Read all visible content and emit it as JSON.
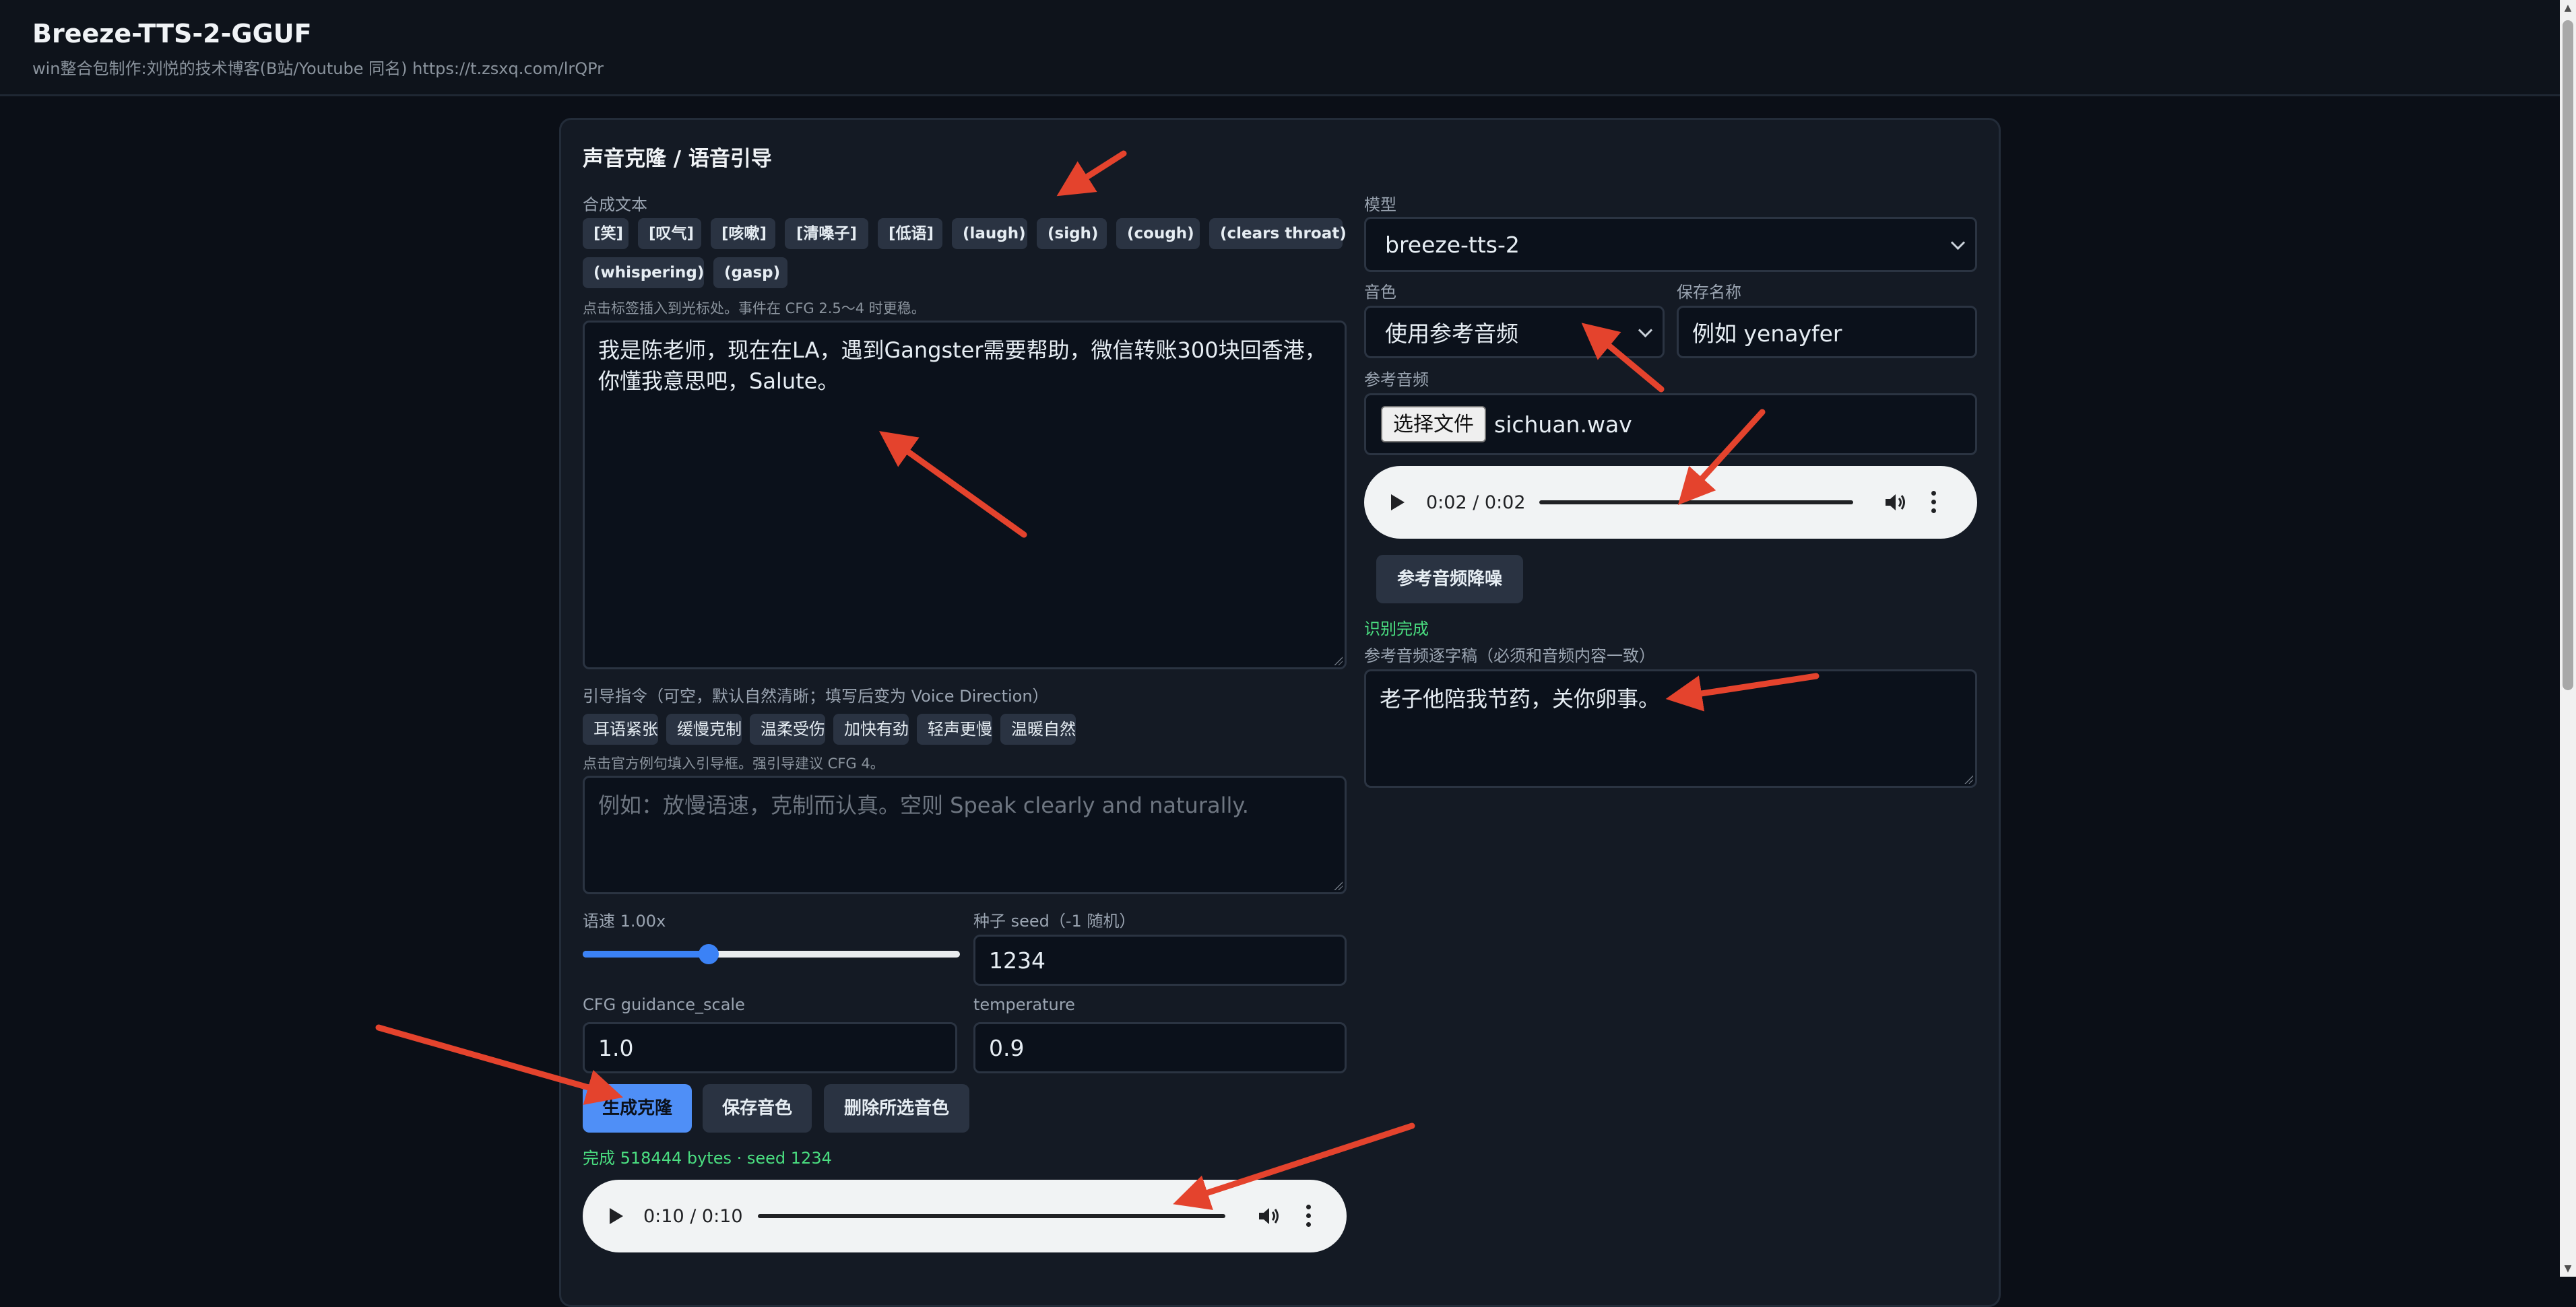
{
  "header": {
    "title": "Breeze-TTS-2-GGUF",
    "subtitle": "win整合包制作:刘悦的技术博客(B站/Youtube 同名) https://t.zsxq.com/lrQPr"
  },
  "card": {
    "title": "声音克隆 / 语音引导"
  },
  "synth": {
    "label": "合成文本",
    "tags": [
      "[笑]",
      "[叹气]",
      "[咳嗽]",
      "[清嗓子]",
      "[低语]",
      "(laugh)",
      "(sigh)",
      "(cough)",
      "(clears throat)",
      "(whispering)",
      "(gasp)"
    ],
    "hint": "点击标签插入到光标处。事件在 CFG 2.5～4 时更稳。",
    "text_line1": "我是陈老师，现在在LA，遇到Gangster需要帮助，微信转账300块回香港，",
    "text_line2": "你懂我意思吧，Salute。"
  },
  "direction": {
    "label": "引导指令（可空，默认自然清晰；填写后变为 Voice Direction）",
    "presets": [
      "耳语紧张",
      "缓慢克制",
      "温柔受伤",
      "加快有劲",
      "轻声更慢",
      "温暖自然"
    ],
    "hint": "点击官方例句填入引导框。强引导建议 CFG 4。",
    "placeholder": "例如：放慢语速，克制而认真。空则 Speak clearly and naturally."
  },
  "speed": {
    "label": "语速 1.00x",
    "value": 1.0,
    "min": 0.5,
    "max": 2.0
  },
  "seed": {
    "label": "种子 seed（-1 随机）",
    "value": "1234"
  },
  "cfg": {
    "label": "CFG guidance_scale",
    "value": "1.0"
  },
  "temperature": {
    "label": "temperature",
    "value": "0.9"
  },
  "actions": {
    "generate": "生成克隆",
    "save_voice": "保存音色",
    "delete_voice": "删除所选音色"
  },
  "result": {
    "status": "完成 518444 bytes · seed 1234",
    "time": "0:10 / 0:10"
  },
  "model": {
    "label": "模型",
    "selected": "breeze-tts-2"
  },
  "voice": {
    "label": "音色",
    "selected": "使用参考音频"
  },
  "save_name": {
    "label": "保存名称",
    "placeholder": "例如 yenayfer"
  },
  "ref_audio": {
    "label": "参考音频",
    "choose_button": "选择文件",
    "file_name": "sichuan.wav",
    "time": "0:02 / 0:02",
    "denoise_button": "参考音频降噪",
    "status": "识别完成"
  },
  "transcript": {
    "label": "参考音频逐字稿（必须和音频内容一致）",
    "text": "老子他陪我节药，关你卵事。"
  },
  "colors": {
    "accent": "#4f8ff7",
    "success": "#4ade80",
    "annotation_arrow": "#e4432d"
  }
}
